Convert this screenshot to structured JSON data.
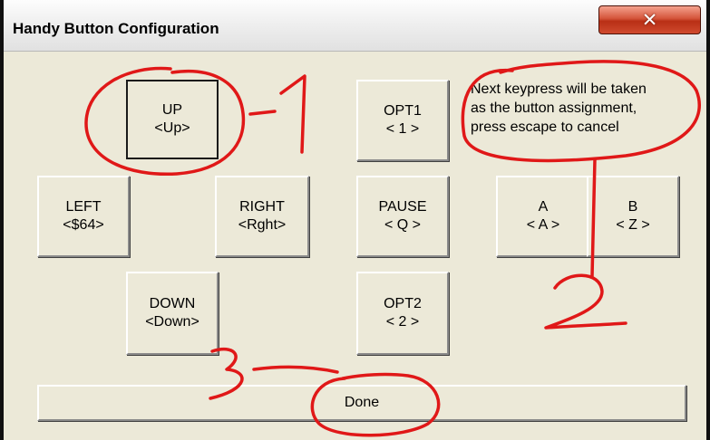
{
  "window": {
    "title": "Handy Button Configuration",
    "close_glyph": "✕"
  },
  "buttons": {
    "up": {
      "name": "UP",
      "key": "<Up>"
    },
    "left": {
      "name": "LEFT",
      "key": "<$64>"
    },
    "right": {
      "name": "RIGHT",
      "key": "<Rght>"
    },
    "down": {
      "name": "DOWN",
      "key": "<Down>"
    },
    "opt1": {
      "name": "OPT1",
      "key": "< 1 >"
    },
    "pause": {
      "name": "PAUSE",
      "key": "< Q >"
    },
    "opt2": {
      "name": "OPT2",
      "key": "< 2 >"
    },
    "a": {
      "name": "A",
      "key": "< A >"
    },
    "b": {
      "name": "B",
      "key": "< Z >"
    },
    "done": {
      "label": "Done"
    }
  },
  "note": {
    "line1": "Next keypress will be taken",
    "line2": "as the button assignment,",
    "line3": "press escape to cancel"
  },
  "annotations": {
    "color": "#e01818",
    "labels": [
      "1",
      "2",
      "3"
    ]
  }
}
